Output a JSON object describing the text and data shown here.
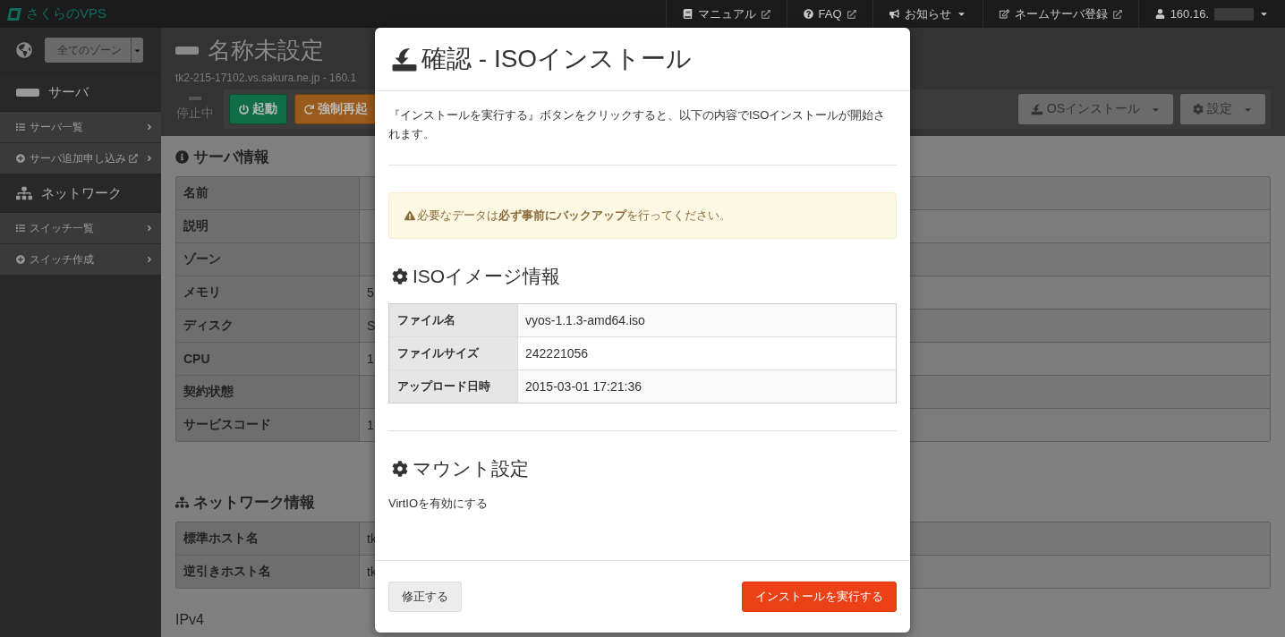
{
  "navbar": {
    "logo": "さくらのVPS",
    "items": [
      {
        "kind": "manual",
        "label": "マニュアル",
        "external": true,
        "dropdown": false
      },
      {
        "kind": "faq",
        "label": "FAQ",
        "external": true,
        "dropdown": false
      },
      {
        "kind": "news",
        "label": "お知らせ",
        "external": false,
        "dropdown": true
      },
      {
        "kind": "nameserver",
        "label": "ネームサーバ登録",
        "external": true,
        "dropdown": false
      },
      {
        "kind": "user",
        "label": "160.16.",
        "external": false,
        "dropdown": true
      }
    ]
  },
  "sidebar": {
    "zone_select": "全てのゾーン",
    "sections": [
      {
        "kind": "server",
        "title": "サーバ",
        "items": [
          {
            "kind": "list",
            "label": "サーバ一覧",
            "external": false
          },
          {
            "kind": "add",
            "label": "サーバ追加申し込み",
            "external": true
          }
        ]
      },
      {
        "kind": "network",
        "title": "ネットワーク",
        "items": [
          {
            "kind": "list",
            "label": "スイッチ一覧",
            "external": false
          },
          {
            "kind": "add",
            "label": "スイッチ作成",
            "external": false
          }
        ]
      }
    ]
  },
  "server": {
    "title": "名称未設定",
    "hostname": "tk2-215-17102.vs.sakura.ne.jp - 160.1",
    "status": "停止中",
    "actions": [
      {
        "kind": "start",
        "label": "起動"
      },
      {
        "kind": "reboot",
        "label": "強制再起"
      }
    ],
    "menus": [
      {
        "kind": "install",
        "label": "OSインストール"
      },
      {
        "kind": "settings",
        "label": "設定"
      }
    ]
  },
  "sections": [
    {
      "kind": "info",
      "title": "サーバ情報",
      "rows": [
        {
          "label": "名前",
          "value": ""
        },
        {
          "label": "説明",
          "value": ""
        },
        {
          "label": "ゾーン",
          "value": ""
        },
        {
          "label": "メモリ",
          "value": "5"
        },
        {
          "label": "ディスク",
          "value": "S"
        },
        {
          "label": "CPU",
          "value": "1"
        },
        {
          "label": "契約状態",
          "value": ""
        },
        {
          "label": "サービスコード",
          "value": "1"
        }
      ]
    },
    {
      "kind": "network",
      "title": "ネットワーク情報",
      "rows": [
        {
          "label": "標準ホスト名",
          "value": "tk"
        },
        {
          "label": "逆引きホスト名",
          "value": "tk"
        }
      ]
    }
  ],
  "ipv4_heading": "IPv4",
  "modal": {
    "title": "確認 - ISOインストール",
    "message": "『インストールを実行する』ボタンをクリックすると、以下の内容でISOインストールが開始されます。",
    "warning": "必要なデータは**必ず事前にバックアップ**を行ってください。",
    "iso": {
      "title": "ISOイメージ情報",
      "rows": [
        {
          "label": "ファイル名",
          "value": "vyos-1.1.3-amd64.iso"
        },
        {
          "label": "ファイルサイズ",
          "value": "242221056"
        },
        {
          "label": "アップロード日時",
          "value": "2015-03-01 17:21:36"
        }
      ]
    },
    "mount": {
      "title": "マウント設定",
      "text": "VirtIOを有効にする"
    },
    "buttons": [
      {
        "kind": "secondary",
        "label": "修正する"
      },
      {
        "kind": "primary",
        "label": "インストールを実行する"
      }
    ]
  }
}
